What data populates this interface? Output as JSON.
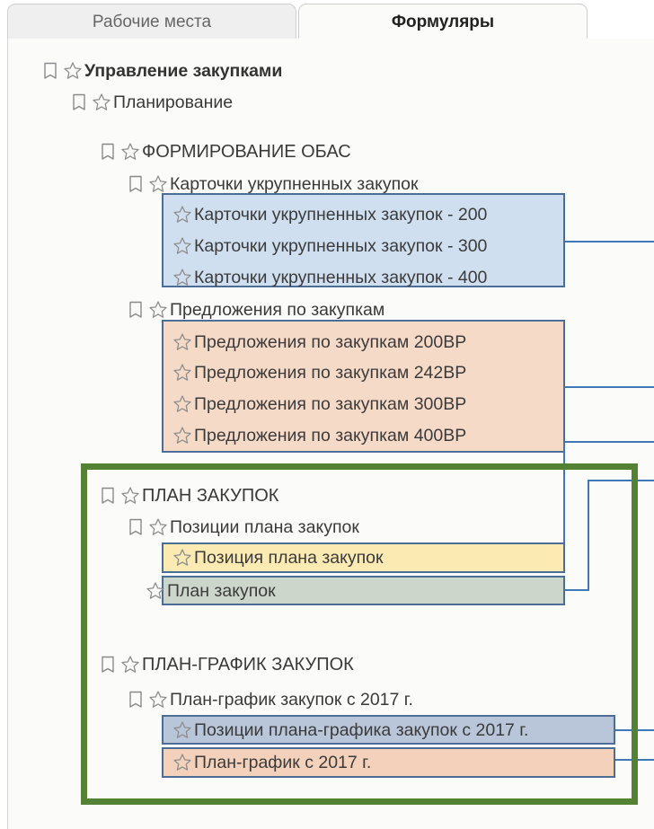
{
  "tabs": {
    "workspaces": "Рабочие места",
    "forms": "Формуляры"
  },
  "tree": {
    "root": "Управление закупками",
    "planning": "Планирование",
    "obas": {
      "title": "ФОРМИРОВАНИЕ ОБАС",
      "cards": {
        "title": "Карточки укрупненных закупок",
        "items": [
          "Карточки укрупненных закупок - 200",
          "Карточки укрупненных закупок - 300",
          "Карточки укрупненных закупок - 400"
        ]
      },
      "proposals": {
        "title": "Предложения по закупкам",
        "items": [
          "Предложения по закупкам 200ВР",
          "Предложения по закупкам 242ВР",
          "Предложения по закупкам 300ВР",
          "Предложения по закупкам 400ВР"
        ]
      }
    },
    "plan": {
      "title": "ПЛАН ЗАКУПОК",
      "positions_title": "Позиции плана закупок",
      "position_item": "Позиция плана закупок",
      "plan_item": "План закупок"
    },
    "schedule": {
      "title": "ПЛАН-ГРАФИК ЗАКУПОК",
      "sub_title": "План-график закупок с 2017 г.",
      "positions_item": "Позиции плана-графика закупок с 2017 г.",
      "schedule_item": "План-график с 2017 г."
    }
  },
  "colors": {
    "frame": "#548235",
    "box_border": "#4c6d95",
    "connector": "#3f78b7"
  }
}
